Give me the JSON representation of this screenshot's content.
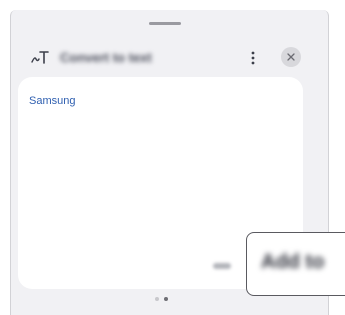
{
  "sheet": {
    "title": "Convert to text",
    "icons": {
      "header": "handwriting-to-text-icon",
      "more": "more-vertical-icon",
      "close": "close-icon"
    }
  },
  "card": {
    "recognized_text": "Samsung"
  },
  "pager": {
    "pages": 2,
    "current_page": 2
  },
  "action": {
    "button_label": "Add to"
  },
  "colors": {
    "sheet_background": "#f1f1f4",
    "card_background": "#ffffff",
    "recognized_text": "#2f5fb0",
    "close_button_background": "#d8d8dc"
  }
}
